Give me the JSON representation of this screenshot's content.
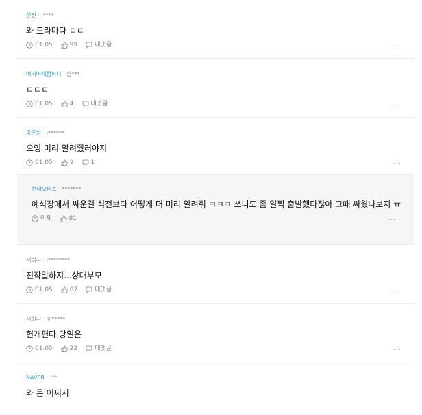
{
  "comments": [
    {
      "company": "선진",
      "author": "l****",
      "text": "와 드라마다 ㄷㄷ",
      "date": "01.05",
      "likes": "99",
      "reply_label": "대댓글",
      "more": "...",
      "is_reply": false
    },
    {
      "company": "여기어때컴퍼니",
      "author": "삼***",
      "text": "ㄷㄷㄷ",
      "date": "01.05",
      "likes": "4",
      "reply_label": "대댓글",
      "more": "...",
      "is_reply": false
    },
    {
      "company": "공무원",
      "author": "l******",
      "text": "으잉 미리 알려줬러야지",
      "date": "01.05",
      "likes": "9",
      "reply_label": "1",
      "more": "...",
      "is_reply": false
    },
    {
      "company": "현대모비스",
      "author": "*******",
      "text": "예식장에서 싸운걸 식전보다 어떻게 더 미리 알려줘 ㅋㅋㅋ 쓰니도 좀 일찍 출발했다잖아 그때 싸웠나보지 ㅠ",
      "date": "어제",
      "likes": "81",
      "reply_label": "",
      "more": "...",
      "is_reply": true
    },
    {
      "company": "새회사",
      "author": "l********",
      "text": "진작말하지...상대부모",
      "date": "01.05",
      "likes": "87",
      "reply_label": "대댓글",
      "more": "...",
      "is_reply": false
    },
    {
      "company": "새회사",
      "author": "ㅎ*****",
      "text": "헌개편다 당일은",
      "date": "01.05",
      "likes": "22",
      "reply_label": "대댓글",
      "more": "...",
      "is_reply": false
    },
    {
      "company": "NAVER",
      "author": "·**",
      "text": "와 돈 어쩌지",
      "date": "",
      "likes": "",
      "reply_label": "",
      "more": "",
      "is_reply": false
    }
  ]
}
